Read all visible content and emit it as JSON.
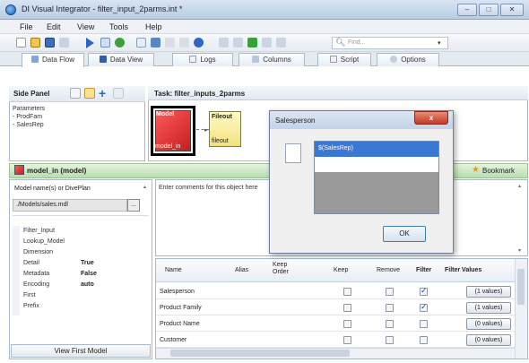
{
  "window": {
    "title": "DI Visual Integrator - filter_input_2parms.int *",
    "controls": [
      "–",
      "□",
      "✕"
    ]
  },
  "menu": [
    "File",
    "Edit",
    "View",
    "Tools",
    "Help"
  ],
  "toolbar": {
    "find_placeholder": "Find..."
  },
  "tabs": [
    "Data Flow",
    "Data View",
    "Logs",
    "Columns",
    "Script",
    "Options"
  ],
  "side_panel": {
    "title": "Side Panel",
    "tree": [
      "Parameters",
      "- ProdFam",
      "- SalesRep"
    ]
  },
  "canvas": {
    "title": "Task: filter_inputs_2parms",
    "nodes": {
      "model": {
        "top": "Model",
        "bottom": "model_in"
      },
      "file": {
        "top": "Fileout",
        "bottom": "fileout"
      }
    }
  },
  "model_bar": {
    "title": "model_in (model)",
    "bookmark": "Bookmark"
  },
  "left_panel": {
    "label": "Model name(s) or DivePlan",
    "path": "./Models/sales.mdl",
    "browse": "...",
    "properties": [
      {
        "name": "Filter_Input",
        "value": ""
      },
      {
        "name": "Lookup_Model",
        "value": ""
      },
      {
        "name": "Dimension",
        "value": ""
      },
      {
        "name": "Detail",
        "value": "True"
      },
      {
        "name": "Metadata",
        "value": "False"
      },
      {
        "name": "Encoding",
        "value": "auto"
      },
      {
        "name": "First",
        "value": ""
      },
      {
        "name": "Prefix",
        "value": ""
      }
    ],
    "view_first_button": "View First Model"
  },
  "comments": {
    "placeholder": "Enter comments for this object here"
  },
  "grid": {
    "headers": {
      "name": "Name",
      "alias": "Alias",
      "keep_order": "Keep Order",
      "keep": "Keep",
      "remove": "Remove",
      "filter": "Filter",
      "filter_values": "Filter Values"
    },
    "rows": [
      {
        "name": "Salesperson",
        "filter": true,
        "values": "(1 values)"
      },
      {
        "name": "Product Family",
        "filter": true,
        "values": "(1 values)"
      },
      {
        "name": "Product Name",
        "filter": false,
        "values": "(0 values)"
      },
      {
        "name": "Customer",
        "filter": false,
        "values": "(0 values)"
      }
    ]
  },
  "dialog": {
    "title": "Salesperson",
    "close": "x",
    "items": [
      "$(SalesRep)"
    ],
    "ok": "OK"
  },
  "colors": {
    "title_bar": "#c3d3e7",
    "selection": "#3a78d6",
    "model_bar": "#b7deae",
    "model_node": "#d92828",
    "file_node": "#f1e27d"
  }
}
